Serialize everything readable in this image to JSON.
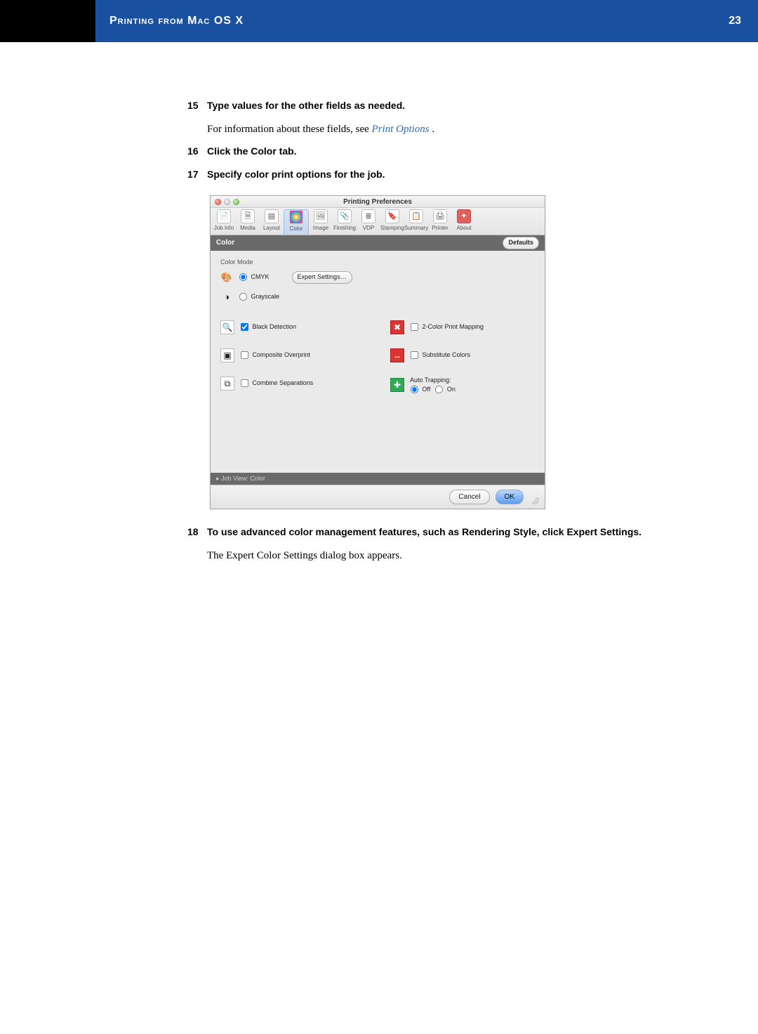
{
  "header": {
    "title": "Printing from Mac OS X",
    "page_number": "23"
  },
  "steps": {
    "s15": {
      "num": "15",
      "title": "Type values for the other fields as needed.",
      "body_prefix": "For information about these fields, see ",
      "body_link": "Print Options",
      "body_suffix": "."
    },
    "s16": {
      "num": "16",
      "title": "Click the Color tab."
    },
    "s17": {
      "num": "17",
      "title": "Specify color print options for the job."
    },
    "s18": {
      "num": "18",
      "title": "To use advanced color management features, such as Rendering Style, click Expert Settings.",
      "body": "The Expert Color Settings dialog box appears."
    }
  },
  "dialog": {
    "window_title": "Printing Preferences",
    "tabs": {
      "job_info": "Job Info",
      "media": "Media",
      "layout": "Layout",
      "color": "Color",
      "image": "Image",
      "finishing": "Finishing",
      "vdp": "VDP",
      "stamping": "Stamping",
      "summary": "Summary",
      "printer": "Printer",
      "about": "About"
    },
    "section_header": "Color",
    "defaults_button": "Defaults",
    "color_mode": {
      "group_label": "Color Mode",
      "cmyk": "CMYK",
      "grayscale": "Grayscale",
      "expert_settings": "Expert Settings…"
    },
    "options": {
      "black_detection": "Black Detection",
      "composite_overprint": "Composite Overprint",
      "combine_separations": "Combine Separations",
      "two_color_print_mapping": "2-Color Print Mapping",
      "substitute_colors": "Substitute Colors",
      "auto_trapping_label": "Auto Trapping:",
      "auto_trapping_off": "Off",
      "auto_trapping_on": "On"
    },
    "status": "Job View: Color",
    "cancel": "Cancel",
    "ok": "OK"
  }
}
